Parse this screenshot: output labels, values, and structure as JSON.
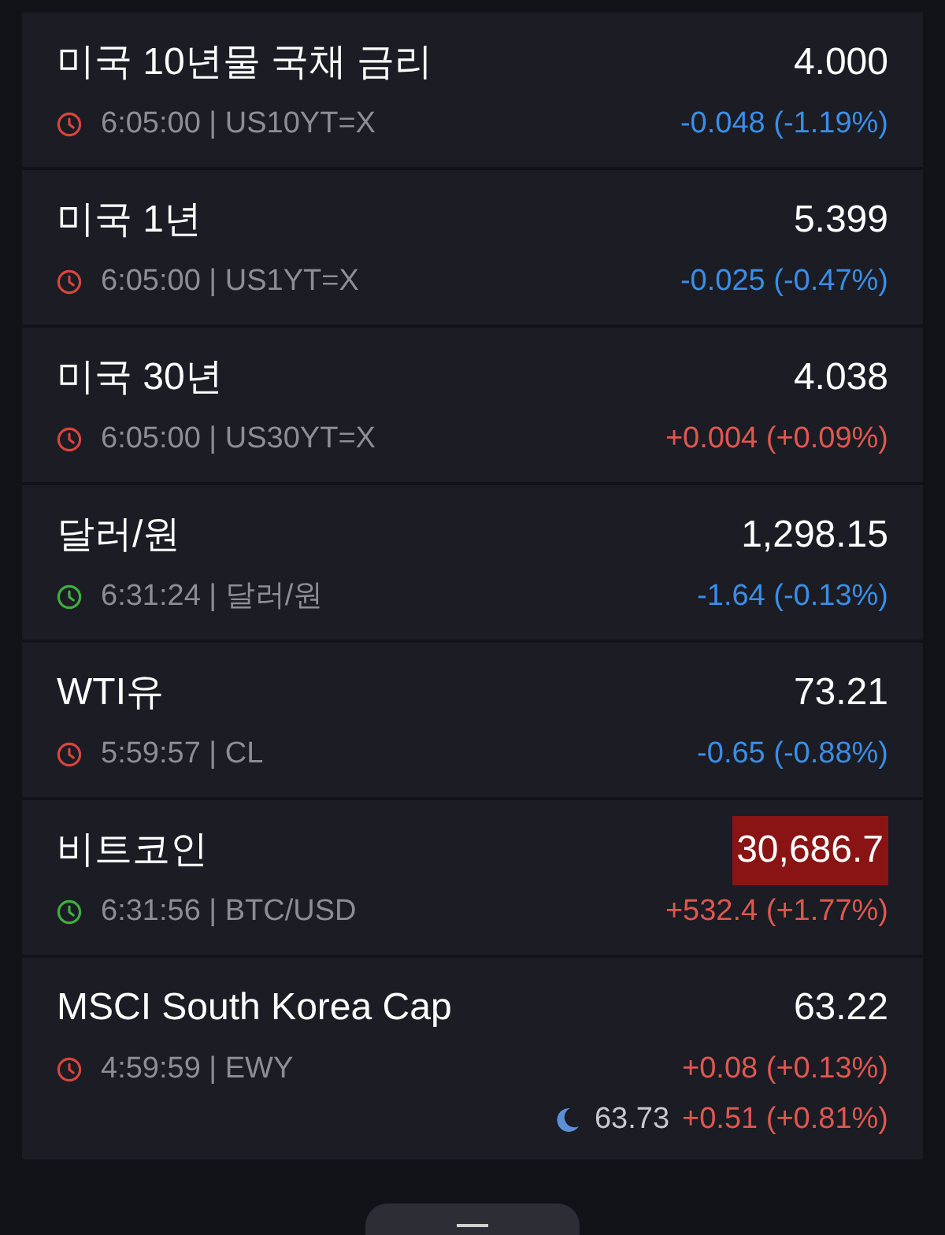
{
  "quotes": [
    {
      "name": "미국 10년물 국채 금리",
      "price": "4.000",
      "meta": "6:05:00 | US10YT=X",
      "change": "-0.048 (-1.19%)",
      "rising": false,
      "market_open": false,
      "flash": false
    },
    {
      "name": "미국 1년",
      "price": "5.399",
      "meta": "6:05:00 | US1YT=X",
      "change": "-0.025 (-0.47%)",
      "rising": false,
      "market_open": false,
      "flash": false
    },
    {
      "name": "미국 30년",
      "price": "4.038",
      "meta": "6:05:00 | US30YT=X",
      "change": "+0.004 (+0.09%)",
      "rising": true,
      "market_open": false,
      "flash": false
    },
    {
      "name": "달러/원",
      "price": "1,298.15",
      "meta": "6:31:24 | 달러/원",
      "change": "-1.64 (-0.13%)",
      "rising": false,
      "market_open": true,
      "flash": false
    },
    {
      "name": "WTI유",
      "price": "73.21",
      "meta": "5:59:57 | CL",
      "change": "-0.65 (-0.88%)",
      "rising": false,
      "market_open": false,
      "flash": false
    },
    {
      "name": "비트코인",
      "price": "30,686.7",
      "meta": "6:31:56 | BTC/USD",
      "change": "+532.4 (+1.77%)",
      "rising": true,
      "market_open": true,
      "flash": true
    },
    {
      "name": "MSCI South Korea Cap",
      "price": "63.22",
      "meta": "4:59:59 | EWY",
      "change": "+0.08 (+0.13%)",
      "rising": true,
      "market_open": false,
      "flash": false,
      "after_hours": {
        "price": "63.73",
        "change": "+0.51 (+0.81%)",
        "rising": true
      }
    }
  ]
}
